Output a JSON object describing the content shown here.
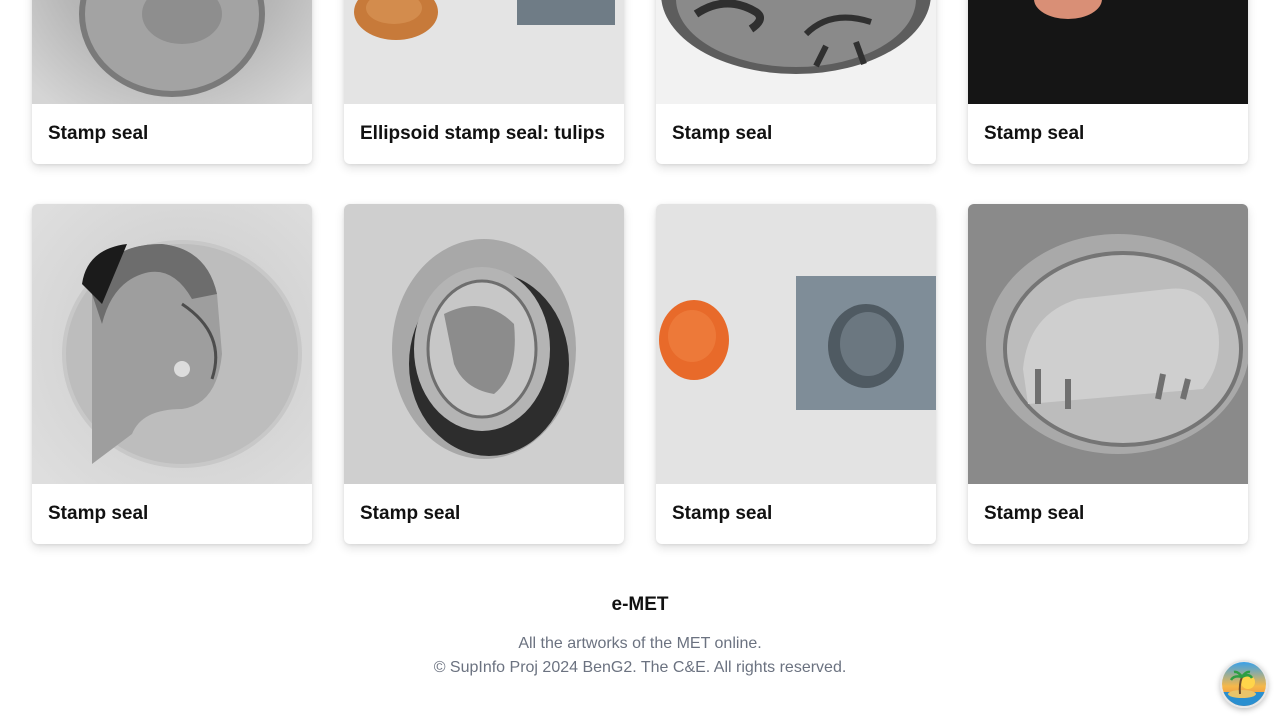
{
  "cards": [
    {
      "title": "Stamp seal"
    },
    {
      "title": "Ellipsoid stamp seal: tulips"
    },
    {
      "title": "Stamp seal"
    },
    {
      "title": "Stamp seal"
    },
    {
      "title": "Stamp seal"
    },
    {
      "title": "Stamp seal"
    },
    {
      "title": "Stamp seal"
    },
    {
      "title": "Stamp seal"
    }
  ],
  "footer": {
    "brand": "e-MET",
    "tagline": "All the artworks of the MET online.",
    "copyright": "© SupInfo Proj 2024 BenG2. The C&E. All rights reserved."
  },
  "fab": {
    "icon": "island-sunset-icon"
  },
  "colors": {
    "card_bg": "#ffffff",
    "footer_text": "#6b7280",
    "title_text": "#111111"
  }
}
